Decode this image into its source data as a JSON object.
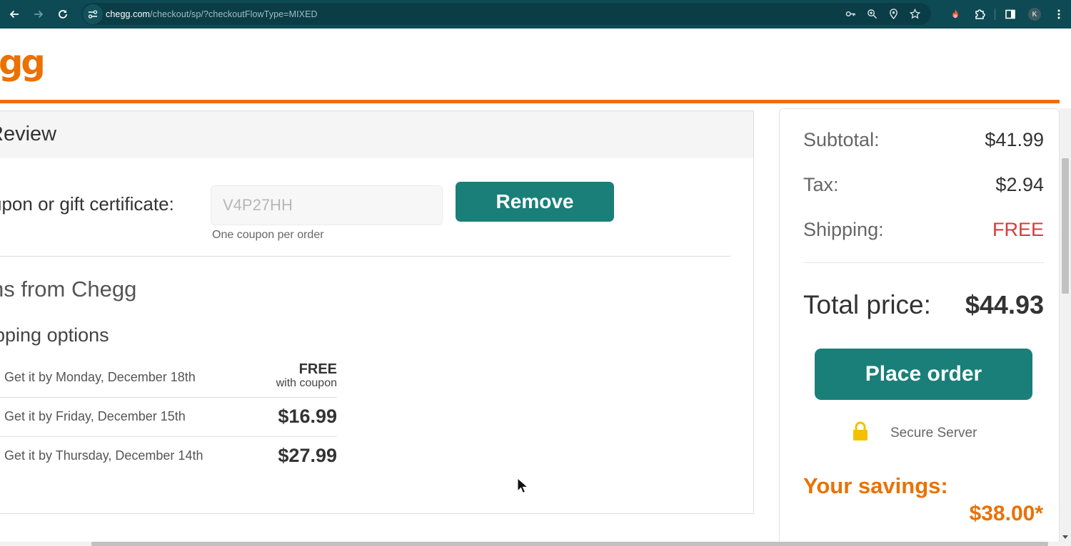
{
  "browser": {
    "url_host": "chegg.com",
    "url_path": "/checkout/sp/?checkoutFlowType=MIXED",
    "profile_initial": "K",
    "icons": [
      "back-icon",
      "forward-icon",
      "reload-icon",
      "site-info-icon",
      "password-key-icon",
      "zoom-icon",
      "location-icon",
      "bookmark-star-icon",
      "extension-fire-icon",
      "extensions-puzzle-icon",
      "side-panel-icon",
      "menu-kebab-icon"
    ]
  },
  "header": {
    "logo_text": "gg",
    "accent_color": "#eb7100"
  },
  "review": {
    "title": "Review"
  },
  "coupon": {
    "label": "upon or gift certificate:",
    "value": "V4P27HH",
    "hint": "One coupon per order",
    "remove_label": "Remove"
  },
  "items": {
    "title": "ns from Chegg"
  },
  "shipping": {
    "title": "ipping options",
    "options": [
      {
        "date": "Get it by Monday, December 18th",
        "price": "FREE",
        "note": "with coupon"
      },
      {
        "date": "Get it by Friday, December 15th",
        "price": "$16.99"
      },
      {
        "date": "Get it by Thursday, December 14th",
        "price": "$27.99"
      }
    ]
  },
  "summary": {
    "subtotal_label": "Subtotal:",
    "subtotal_value": "$41.99",
    "tax_label": "Tax:",
    "tax_value": "$2.94",
    "shipping_label": "Shipping:",
    "shipping_value": "FREE",
    "total_label": "Total price:",
    "total_value": "$44.93",
    "place_order_label": "Place order",
    "secure_label": "Secure Server",
    "savings_label": "Your savings:",
    "savings_value": "$38.00*",
    "button_color": "#1a7f78"
  }
}
